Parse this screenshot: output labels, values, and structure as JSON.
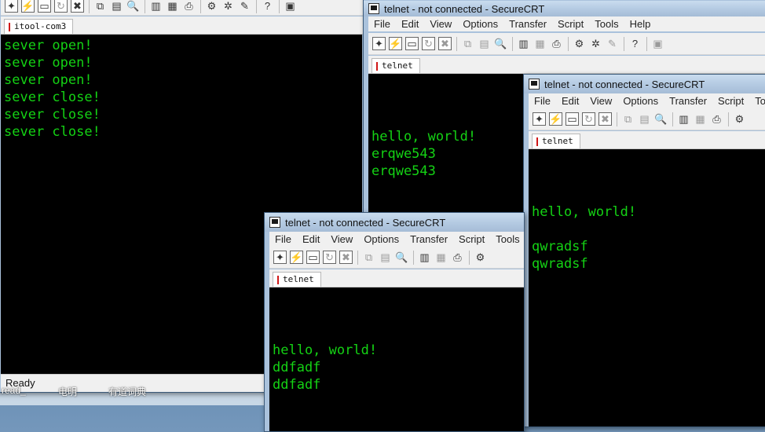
{
  "win1": {
    "tab": "itool-com3",
    "lines": [
      "sever open!",
      "sever open!",
      "sever open!",
      "sever close!",
      "sever close!",
      "sever close!"
    ],
    "status": "Ready"
  },
  "win2": {
    "title": "telnet - not connected - SecureCRT",
    "menu": [
      "File",
      "Edit",
      "View",
      "Options",
      "Transfer",
      "Script",
      "Tools",
      "Help"
    ],
    "tab": "telnet",
    "lines": [
      "",
      "",
      "",
      "hello, world!",
      "erqwe543",
      "erqwe543"
    ]
  },
  "win3": {
    "title": "telnet - not connected - SecureCRT",
    "menu": [
      "File",
      "Edit",
      "View",
      "Options",
      "Transfer",
      "Script",
      "Too"
    ],
    "tab": "telnet",
    "lines": [
      "",
      "",
      "",
      "hello, world!",
      "",
      "qwradsf",
      "qwradsf"
    ]
  },
  "win4": {
    "title": "telnet - not connected - SecureCRT",
    "menu": [
      "File",
      "Edit",
      "View",
      "Options",
      "Transfer",
      "Script",
      "Tools"
    ],
    "tab": "telnet",
    "lines": [
      "",
      "",
      "",
      "hello, world!",
      "ddfadf",
      "ddfadf"
    ]
  },
  "taskbar": [
    "read_",
    "电明",
    "有道词典"
  ]
}
